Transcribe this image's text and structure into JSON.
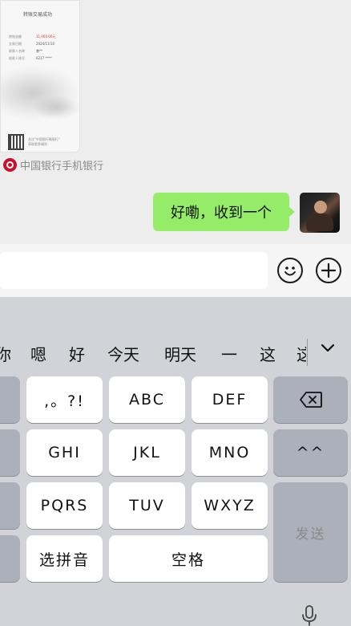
{
  "chat": {
    "receipt": {
      "title": "转账交易成功",
      "rows": [
        {
          "label": "转账金额",
          "value": "11,000.00元"
        },
        {
          "label": "交易日期",
          "value": "2024/11/10"
        },
        {
          "label": "收款人名称",
          "value": "曾**"
        },
        {
          "label": "收款人账号",
          "value": "6217 ****"
        }
      ],
      "qr_text": "关注\"中国银行微银行\"\n获取更多福利"
    },
    "source_label": "中国银行手机银行",
    "message": "好嘞，收到一个"
  },
  "input_bar": {
    "emoji_icon": "smiley-face-icon",
    "plus_icon": "plus-circle-icon"
  },
  "keyboard": {
    "candidates": [
      "你",
      "嗯",
      "好",
      "今天",
      "明天",
      "一",
      "这",
      "这"
    ],
    "collapse_icon": "chevron-down-icon",
    "keys": {
      "punct": ",。?!",
      "abc": "ABC",
      "def": "DEF",
      "ghi": "GHI",
      "jkl": "JKL",
      "mno": "MNO",
      "pqrs": "PQRS",
      "tuv": "TUV",
      "wxyz": "WXYZ",
      "pinyin": "选拼音",
      "space": "空格",
      "send": "发送",
      "tone": "^^"
    },
    "backspace_icon": "backspace-icon",
    "mic_icon": "microphone-icon"
  },
  "colors": {
    "bubble": "#95ec69",
    "boc_red": "#c8102e",
    "keyboard_bg": "#d1d3d9"
  }
}
